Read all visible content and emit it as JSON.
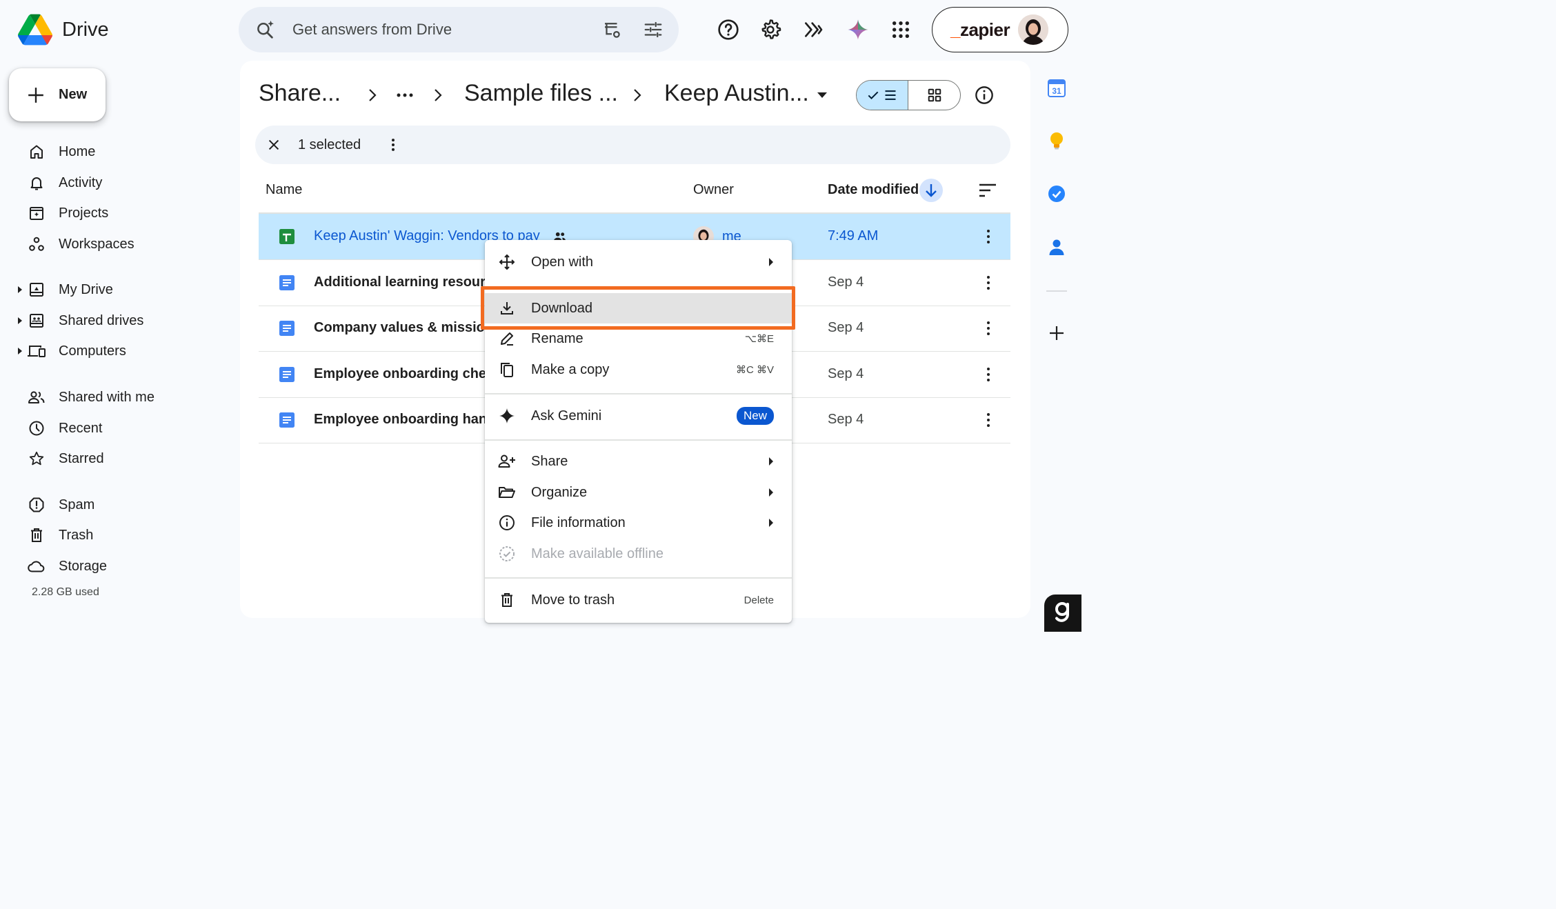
{
  "app": {
    "name": "Drive"
  },
  "search": {
    "placeholder": "Get answers from Drive"
  },
  "account": {
    "brand": "zapier"
  },
  "new_button": {
    "label": "New"
  },
  "nav": {
    "home": "Home",
    "activity": "Activity",
    "projects": "Projects",
    "workspaces": "Workspaces",
    "my_drive": "My Drive",
    "shared_drives": "Shared drives",
    "computers": "Computers",
    "shared_with_me": "Shared with me",
    "recent": "Recent",
    "starred": "Starred",
    "spam": "Spam",
    "trash": "Trash",
    "storage": "Storage",
    "storage_used": "2.28 GB used"
  },
  "breadcrumb": {
    "items": [
      "Share...",
      "Sample files ...",
      "Keep Austin..."
    ]
  },
  "selection": {
    "count_label": "1 selected"
  },
  "columns": {
    "name": "Name",
    "owner": "Owner",
    "date_modified": "Date modified"
  },
  "files": [
    {
      "name": "Keep Austin' Waggin: Vendors to pay",
      "type": "sheet",
      "shared": true,
      "owner": "me",
      "modified": "7:49 AM",
      "selected": true
    },
    {
      "name": "Additional learning resources",
      "type": "doc",
      "modified": "Sep 4"
    },
    {
      "name": "Company values & mission",
      "type": "doc",
      "modified": "Sep 4"
    },
    {
      "name": "Employee onboarding checklist",
      "type": "doc",
      "modified": "Sep 4"
    },
    {
      "name": "Employee onboarding handbook",
      "type": "doc",
      "modified": "Sep 4"
    }
  ],
  "context_menu": {
    "open_with": "Open with",
    "download": "Download",
    "rename": "Rename",
    "rename_shortcut": "⌥⌘E",
    "make_copy": "Make a copy",
    "make_copy_shortcut": "⌘C ⌘V",
    "ask_gemini": "Ask Gemini",
    "ask_gemini_badge": "New",
    "share": "Share",
    "organize": "Organize",
    "file_information": "File information",
    "make_offline": "Make available offline",
    "move_to_trash": "Move to trash",
    "move_to_trash_shortcut": "Delete",
    "highlighted_item": "Download"
  },
  "right_rail": {
    "calendar_day": "31"
  },
  "colors": {
    "selected_row": "#c2e7ff",
    "accent": "#0b57d0",
    "highlight_outline": "#f26b21"
  }
}
